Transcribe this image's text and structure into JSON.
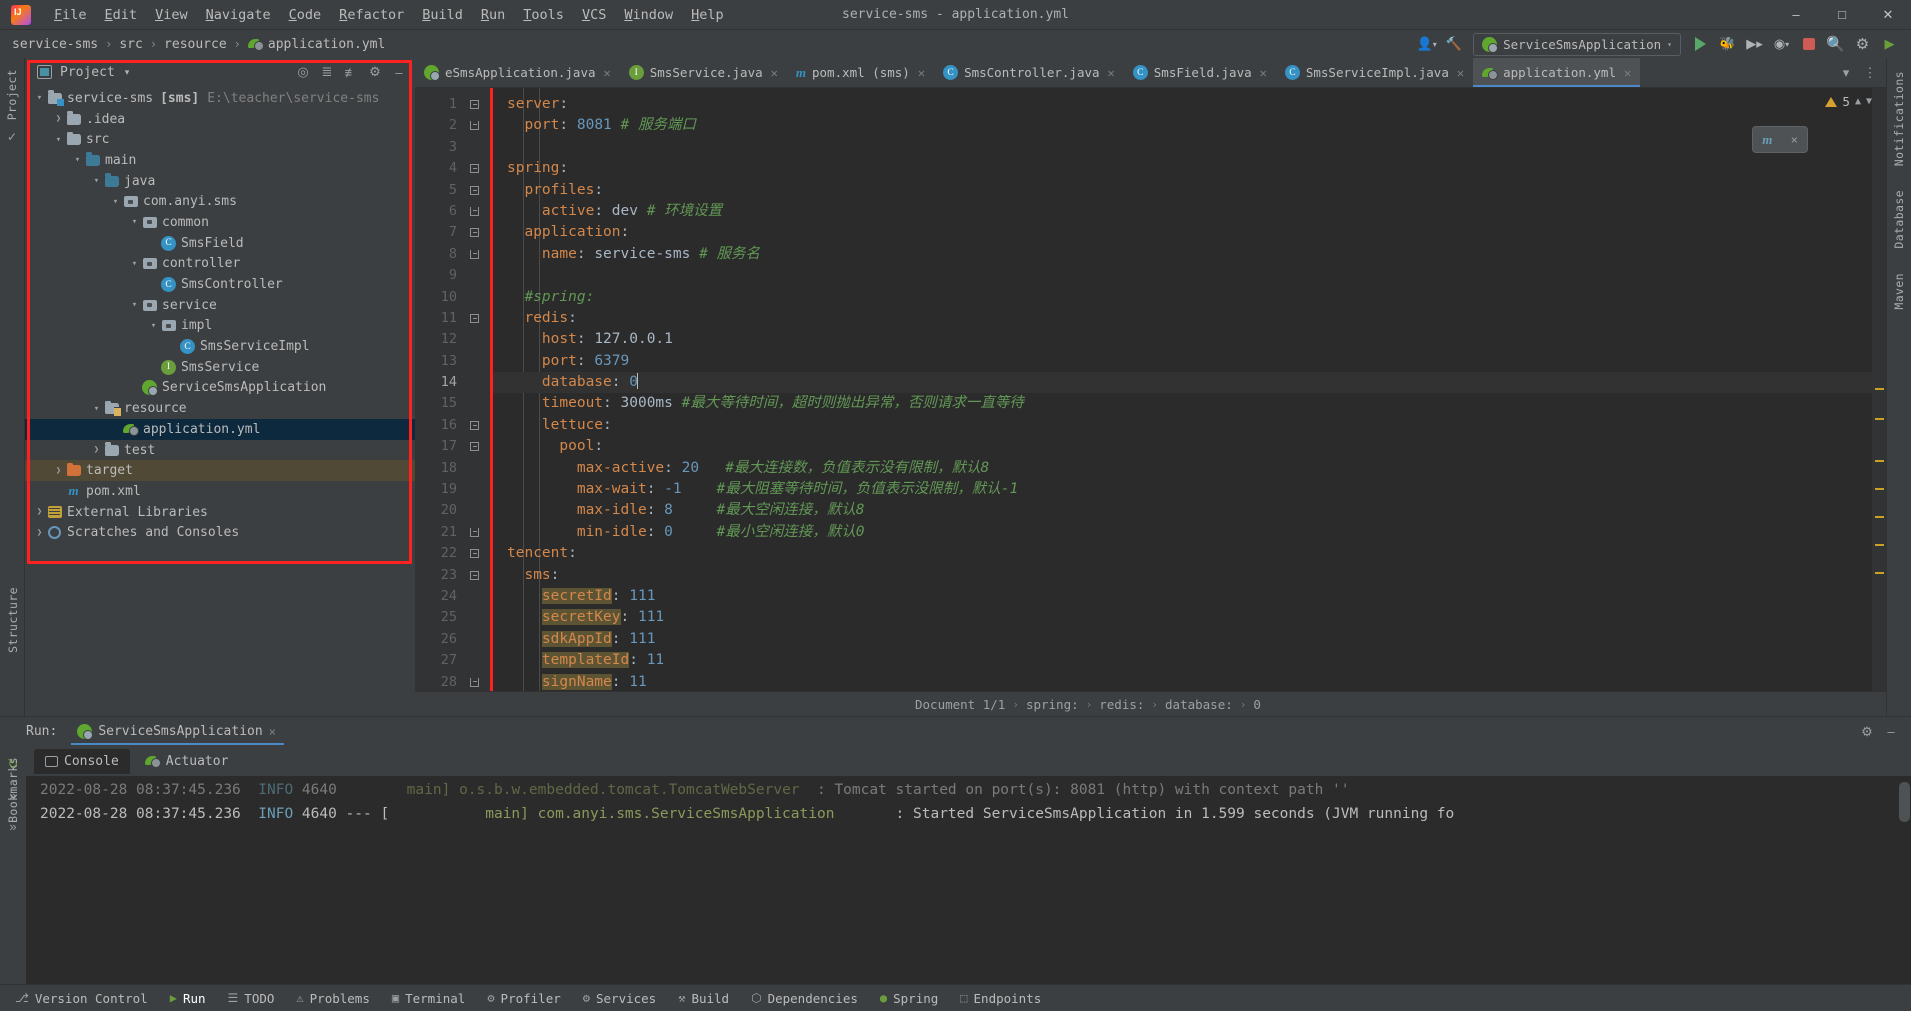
{
  "window": {
    "title": "service-sms - application.yml",
    "controls": [
      "minimize",
      "maximize",
      "close"
    ]
  },
  "menubar": {
    "logo": "intellij-logo",
    "items": [
      "File",
      "Edit",
      "View",
      "Navigate",
      "Code",
      "Refactor",
      "Build",
      "Run",
      "Tools",
      "VCS",
      "Window",
      "Help"
    ]
  },
  "breadcrumb": {
    "items": [
      "service-sms",
      "src",
      "resource",
      "application.yml"
    ],
    "separator": "›"
  },
  "navbar_right": {
    "run_config": "ServiceSmsApplication",
    "icons": [
      "user-icon",
      "hammer-icon",
      "run-icon",
      "debug-icon",
      "coverage-icon",
      "profile-icon",
      "stop-icon",
      "search-icon",
      "settings-icon",
      "updates-icon"
    ]
  },
  "project_panel": {
    "title": "Project",
    "tools": [
      "locate-icon",
      "expand-all-icon",
      "collapse-all-icon",
      "gear-icon",
      "hide-icon"
    ],
    "tree": [
      {
        "depth": 0,
        "arrow": "down",
        "icon": "module-folder",
        "label": "service-sms",
        "bold_label": "[sms]",
        "path": "E:\\teacher\\service-sms",
        "state": "normal"
      },
      {
        "depth": 1,
        "arrow": "right",
        "icon": "folder",
        "label": ".idea",
        "state": "normal"
      },
      {
        "depth": 1,
        "arrow": "down",
        "icon": "folder",
        "label": "src",
        "state": "normal"
      },
      {
        "depth": 2,
        "arrow": "down",
        "icon": "folder-blue",
        "label": "main",
        "state": "normal"
      },
      {
        "depth": 3,
        "arrow": "down",
        "icon": "folder-blue",
        "label": "java",
        "state": "normal"
      },
      {
        "depth": 4,
        "arrow": "down",
        "icon": "package",
        "label": "com.anyi.sms",
        "state": "normal"
      },
      {
        "depth": 5,
        "arrow": "down",
        "icon": "package",
        "label": "common",
        "state": "normal"
      },
      {
        "depth": 6,
        "arrow": "none",
        "icon": "class",
        "label": "SmsField",
        "state": "normal"
      },
      {
        "depth": 5,
        "arrow": "down",
        "icon": "package",
        "label": "controller",
        "state": "normal"
      },
      {
        "depth": 6,
        "arrow": "none",
        "icon": "class",
        "label": "SmsController",
        "state": "normal"
      },
      {
        "depth": 5,
        "arrow": "down",
        "icon": "package",
        "label": "service",
        "state": "normal"
      },
      {
        "depth": 6,
        "arrow": "down",
        "icon": "package",
        "label": "impl",
        "state": "normal"
      },
      {
        "depth": 7,
        "arrow": "none",
        "icon": "class",
        "label": "SmsServiceImpl",
        "state": "normal"
      },
      {
        "depth": 6,
        "arrow": "none",
        "icon": "interface",
        "label": "SmsService",
        "state": "normal"
      },
      {
        "depth": 5,
        "arrow": "none",
        "icon": "spring-app",
        "label": "ServiceSmsApplication",
        "state": "normal"
      },
      {
        "depth": 3,
        "arrow": "down",
        "icon": "folder-resource",
        "label": "resource",
        "state": "normal"
      },
      {
        "depth": 4,
        "arrow": "none",
        "icon": "yml-leaf",
        "label": "application.yml",
        "state": "selected"
      },
      {
        "depth": 3,
        "arrow": "right",
        "icon": "folder",
        "label": "test",
        "state": "normal"
      },
      {
        "depth": 1,
        "arrow": "right",
        "icon": "folder-orange",
        "label": "target",
        "state": "highlighted"
      },
      {
        "depth": 1,
        "arrow": "none",
        "icon": "maven",
        "label": "pom.xml",
        "state": "normal"
      },
      {
        "depth": 0,
        "arrow": "right",
        "icon": "library",
        "label": "External Libraries",
        "state": "normal"
      },
      {
        "depth": 0,
        "arrow": "right",
        "icon": "scratch",
        "label": "Scratches and Consoles",
        "state": "normal"
      }
    ]
  },
  "left_rail": {
    "items": [
      "Project",
      "Commit"
    ]
  },
  "right_rail": {
    "items": [
      "Notifications",
      "Database",
      "Maven"
    ]
  },
  "bottom_left_rail": {
    "items": [
      "Structure",
      "Bookmarks"
    ]
  },
  "editor_tabs": [
    {
      "icon": "spring-app",
      "label": "eSmsApplication.java",
      "active": false
    },
    {
      "icon": "interface",
      "label": "SmsService.java",
      "active": false
    },
    {
      "icon": "maven",
      "label": "pom.xml (sms)",
      "active": false
    },
    {
      "icon": "class",
      "label": "SmsController.java",
      "active": false
    },
    {
      "icon": "class",
      "label": "SmsField.java",
      "active": false
    },
    {
      "icon": "class",
      "label": "SmsServiceImpl.java",
      "active": false
    },
    {
      "icon": "yml-leaf",
      "label": "application.yml",
      "active": true
    }
  ],
  "editor": {
    "inspection_count": "5",
    "float_badge": {
      "icon": "m-icon",
      "close": "×"
    },
    "lines": [
      {
        "num": "1",
        "fold": "minus",
        "cur": false,
        "tokens": [
          {
            "t": "server",
            "c": "k"
          },
          {
            "t": ":",
            "c": "p"
          }
        ]
      },
      {
        "num": "2",
        "fold": "end",
        "cur": false,
        "tokens": [
          {
            "t": "  port",
            "c": "k"
          },
          {
            "t": ": ",
            "c": "p"
          },
          {
            "t": "8081",
            "c": "n"
          },
          {
            "t": " ",
            "c": "p"
          },
          {
            "t": "# 服务端口",
            "c": "c"
          }
        ]
      },
      {
        "num": "3",
        "fold": "",
        "cur": false,
        "tokens": []
      },
      {
        "num": "4",
        "fold": "minus",
        "cur": false,
        "tokens": [
          {
            "t": "spring",
            "c": "k"
          },
          {
            "t": ":",
            "c": "p"
          }
        ]
      },
      {
        "num": "5",
        "fold": "minus",
        "cur": false,
        "tokens": [
          {
            "t": "  profiles",
            "c": "k"
          },
          {
            "t": ":",
            "c": "p"
          }
        ]
      },
      {
        "num": "6",
        "fold": "end",
        "cur": false,
        "tokens": [
          {
            "t": "    active",
            "c": "k"
          },
          {
            "t": ": ",
            "c": "p"
          },
          {
            "t": "dev",
            "c": "s"
          },
          {
            "t": " ",
            "c": "p"
          },
          {
            "t": "# 环境设置",
            "c": "c"
          }
        ]
      },
      {
        "num": "7",
        "fold": "minus",
        "cur": false,
        "tokens": [
          {
            "t": "  application",
            "c": "k"
          },
          {
            "t": ":",
            "c": "p"
          }
        ]
      },
      {
        "num": "8",
        "fold": "end",
        "cur": false,
        "tokens": [
          {
            "t": "    name",
            "c": "k"
          },
          {
            "t": ": ",
            "c": "p"
          },
          {
            "t": "service-sms",
            "c": "s"
          },
          {
            "t": " ",
            "c": "p"
          },
          {
            "t": "# 服务名",
            "c": "c"
          }
        ]
      },
      {
        "num": "9",
        "fold": "",
        "cur": false,
        "tokens": []
      },
      {
        "num": "10",
        "fold": "",
        "cur": false,
        "tokens": [
          {
            "t": "  #spring:",
            "c": "c"
          }
        ]
      },
      {
        "num": "11",
        "fold": "minus",
        "cur": false,
        "tokens": [
          {
            "t": "  redis",
            "c": "k"
          },
          {
            "t": ":",
            "c": "p"
          }
        ]
      },
      {
        "num": "12",
        "fold": "",
        "cur": false,
        "tokens": [
          {
            "t": "    host",
            "c": "k"
          },
          {
            "t": ": ",
            "c": "p"
          },
          {
            "t": "127.0.0.1",
            "c": "s"
          }
        ]
      },
      {
        "num": "13",
        "fold": "",
        "cur": false,
        "tokens": [
          {
            "t": "    port",
            "c": "k"
          },
          {
            "t": ": ",
            "c": "p"
          },
          {
            "t": "6379",
            "c": "n"
          }
        ]
      },
      {
        "num": "14",
        "fold": "",
        "cur": true,
        "tokens": [
          {
            "t": "    database",
            "c": "k"
          },
          {
            "t": ": ",
            "c": "p"
          },
          {
            "t": "0",
            "c": "n"
          },
          {
            "t": "|caret|",
            "c": "caret"
          }
        ]
      },
      {
        "num": "15",
        "fold": "",
        "cur": false,
        "tokens": [
          {
            "t": "    timeout",
            "c": "k"
          },
          {
            "t": ": ",
            "c": "p"
          },
          {
            "t": "3000ms",
            "c": "s"
          },
          {
            "t": " ",
            "c": "p"
          },
          {
            "t": "#最大等待时间，超时则抛出异常，否则请求一直等待",
            "c": "c"
          }
        ]
      },
      {
        "num": "16",
        "fold": "minus",
        "cur": false,
        "tokens": [
          {
            "t": "    lettuce",
            "c": "k"
          },
          {
            "t": ":",
            "c": "p"
          }
        ]
      },
      {
        "num": "17",
        "fold": "minus",
        "cur": false,
        "tokens": [
          {
            "t": "      pool",
            "c": "k"
          },
          {
            "t": ":",
            "c": "p"
          }
        ]
      },
      {
        "num": "18",
        "fold": "",
        "cur": false,
        "tokens": [
          {
            "t": "        max-active",
            "c": "k"
          },
          {
            "t": ": ",
            "c": "p"
          },
          {
            "t": "20",
            "c": "n"
          },
          {
            "t": "   ",
            "c": "p"
          },
          {
            "t": "#最大连接数，负值表示没有限制，默认8",
            "c": "c"
          }
        ]
      },
      {
        "num": "19",
        "fold": "",
        "cur": false,
        "tokens": [
          {
            "t": "        max-wait",
            "c": "k"
          },
          {
            "t": ": ",
            "c": "p"
          },
          {
            "t": "-1",
            "c": "n"
          },
          {
            "t": "    ",
            "c": "p"
          },
          {
            "t": "#最大阻塞等待时间，负值表示没限制，默认-1",
            "c": "c"
          }
        ]
      },
      {
        "num": "20",
        "fold": "",
        "cur": false,
        "tokens": [
          {
            "t": "        max-idle",
            "c": "k"
          },
          {
            "t": ": ",
            "c": "p"
          },
          {
            "t": "8",
            "c": "n"
          },
          {
            "t": "     ",
            "c": "p"
          },
          {
            "t": "#最大空闲连接，默认8",
            "c": "c"
          }
        ]
      },
      {
        "num": "21",
        "fold": "end",
        "cur": false,
        "tokens": [
          {
            "t": "        min-idle",
            "c": "k"
          },
          {
            "t": ": ",
            "c": "p"
          },
          {
            "t": "0",
            "c": "n"
          },
          {
            "t": "     ",
            "c": "p"
          },
          {
            "t": "#最小空闲连接，默认0",
            "c": "c"
          }
        ]
      },
      {
        "num": "22",
        "fold": "minus",
        "cur": false,
        "tokens": [
          {
            "t": "tencent",
            "c": "k"
          },
          {
            "t": ":",
            "c": "p"
          }
        ]
      },
      {
        "num": "23",
        "fold": "minus",
        "cur": false,
        "tokens": [
          {
            "t": "  sms",
            "c": "k"
          },
          {
            "t": ":",
            "c": "p"
          }
        ]
      },
      {
        "num": "24",
        "fold": "",
        "cur": false,
        "tokens": [
          {
            "t": "    ",
            "c": "p"
          },
          {
            "t": "secretId",
            "c": "k hl"
          },
          {
            "t": ": ",
            "c": "p"
          },
          {
            "t": "111",
            "c": "n"
          }
        ]
      },
      {
        "num": "25",
        "fold": "",
        "cur": false,
        "tokens": [
          {
            "t": "    ",
            "c": "p"
          },
          {
            "t": "secretKey",
            "c": "k hl"
          },
          {
            "t": ": ",
            "c": "p"
          },
          {
            "t": "111",
            "c": "n"
          }
        ]
      },
      {
        "num": "26",
        "fold": "",
        "cur": false,
        "tokens": [
          {
            "t": "    ",
            "c": "p"
          },
          {
            "t": "sdkAppId",
            "c": "k hl"
          },
          {
            "t": ": ",
            "c": "p"
          },
          {
            "t": "111",
            "c": "n"
          }
        ]
      },
      {
        "num": "27",
        "fold": "",
        "cur": false,
        "tokens": [
          {
            "t": "    ",
            "c": "p"
          },
          {
            "t": "templateId",
            "c": "k hl"
          },
          {
            "t": ": ",
            "c": "p"
          },
          {
            "t": "11",
            "c": "n"
          }
        ]
      },
      {
        "num": "28",
        "fold": "end",
        "cur": false,
        "tokens": [
          {
            "t": "    ",
            "c": "p"
          },
          {
            "t": "signName",
            "c": "k hl"
          },
          {
            "t": ": ",
            "c": "p"
          },
          {
            "t": "11",
            "c": "n"
          }
        ]
      }
    ]
  },
  "editor_breadcrumb": {
    "items": [
      "Document 1/1",
      "spring:",
      "redis:",
      "database:",
      "0"
    ],
    "separator": "›"
  },
  "run_panel": {
    "label": "Run:",
    "config_name": "ServiceSmsApplication",
    "close": "×",
    "tabs": [
      {
        "label": "Console",
        "icon": "console-icon",
        "active": true
      },
      {
        "label": "Actuator",
        "icon": "actuator-icon",
        "active": false
      }
    ],
    "header_icons": [
      "gear-icon",
      "minimize-icon"
    ],
    "rail_icons": [
      "rerun-icon",
      "expand-icon",
      "expand2-icon"
    ],
    "console_lines": [
      {
        "dim": true,
        "segments": [
          {
            "t": "2022-08-28 08:37:45.236  ",
            "c": "cw"
          },
          {
            "t": "INFO",
            "c": "ci"
          },
          {
            "t": " 4640",
            "c": "cw"
          },
          {
            "t": "        ",
            "c": "cw"
          },
          {
            "t": "main] ",
            "c": "cg"
          },
          {
            "t": "o.s.b.w.embedded.tomcat.TomcatWebServer  ",
            "c": "cg"
          },
          {
            "t": ": Tomcat started on port(s): 8081 (http) with context path ''",
            "c": "cw"
          }
        ]
      },
      {
        "dim": false,
        "segments": [
          {
            "t": "2022-08-28 08:37:45.236  ",
            "c": "cw"
          },
          {
            "t": "INFO",
            "c": "ci"
          },
          {
            "t": " 4640 --- [           ",
            "c": "cw"
          },
          {
            "t": "main] ",
            "c": "cg"
          },
          {
            "t": "com.anyi.sms.ServiceSmsApplication       ",
            "c": "cg"
          },
          {
            "t": ": Started ServiceSmsApplication in 1.599 seconds (JVM running fo",
            "c": "cw"
          }
        ]
      }
    ]
  },
  "statusbar": {
    "items": [
      {
        "label": "Version Control",
        "icon": "vcs-icon"
      },
      {
        "label": "Run",
        "icon": "run-icon",
        "active": true
      },
      {
        "label": "TODO",
        "icon": "todo-icon"
      },
      {
        "label": "Problems",
        "icon": "problems-icon"
      },
      {
        "label": "Terminal",
        "icon": "terminal-icon"
      },
      {
        "label": "Profiler",
        "icon": "profiler-icon"
      },
      {
        "label": "Services",
        "icon": "services-icon"
      },
      {
        "label": "Build",
        "icon": "build-icon"
      },
      {
        "label": "Dependencies",
        "icon": "dependencies-icon"
      },
      {
        "label": "Spring",
        "icon": "spring-icon"
      },
      {
        "label": "Endpoints",
        "icon": "endpoints-icon"
      }
    ]
  },
  "colors": {
    "bg_panel": "#3c3f41",
    "bg_editor": "#2b2b2b",
    "accent_blue": "#4a88c7",
    "selection": "#0d293e",
    "highlight_box": "#ff2020",
    "key_orange": "#d3874b",
    "number_blue": "#6897bb",
    "comment_green": "#629755",
    "token_highlight": "#5d5434",
    "target_row": "#4f4935"
  }
}
